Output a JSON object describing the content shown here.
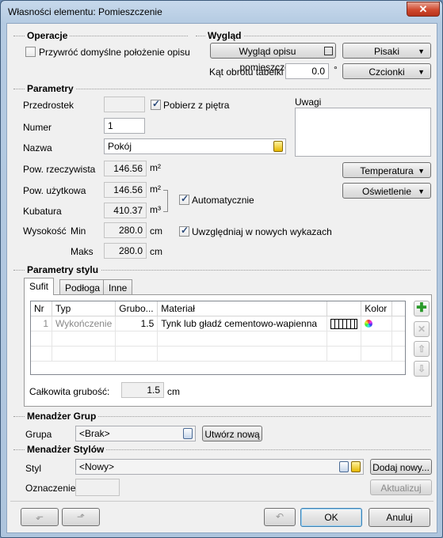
{
  "window": {
    "title": "Własności elementu: Pomieszczenie",
    "close": "✕"
  },
  "operacje": {
    "header": "Operacje",
    "restore_label": "Przywróć domyślne położenie opisu",
    "restore_checked": false
  },
  "wyglad": {
    "header": "Wygląd",
    "room_desc_button": "Wygląd opisu pomieszczeń",
    "pisaki_button": "Pisaki",
    "angle_label": "Kąt obrotu tabelki",
    "angle_value": "0.0",
    "angle_unit": "°",
    "czcionki_button": "Czcionki"
  },
  "parametry": {
    "header": "Parametry",
    "prefix_label": "Przedrostek",
    "prefix_value": "",
    "take_from_floor_label": "Pobierz z piętra",
    "take_from_floor_checked": true,
    "number_label": "Numer",
    "number_value": "1",
    "name_label": "Nazwa",
    "name_value": "Pokój",
    "notes_label": "Uwagi",
    "notes_value": "",
    "real_area_label": "Pow. rzeczywista",
    "real_area_value": "146.56",
    "real_area_unit": "m²",
    "usable_area_label": "Pow. użytkowa",
    "usable_area_value": "146.56",
    "usable_area_unit": "m²",
    "volume_label": "Kubatura",
    "volume_value": "410.37",
    "volume_unit": "m³",
    "auto_label": "Automatycznie",
    "auto_checked": true,
    "height_label": "Wysokość",
    "min_label": "Min",
    "min_value": "280.0",
    "min_unit": "cm",
    "max_label": "Maks",
    "max_value": "280.0",
    "max_unit": "cm",
    "include_label": "Uwzględniaj w nowych wykazach",
    "include_checked": true,
    "temperature_button": "Temperatura",
    "lighting_button": "Oświetlenie"
  },
  "styl": {
    "header": "Parametry stylu",
    "tabs": [
      "Sufit",
      "Podłoga",
      "Inne"
    ],
    "active_tab": "Sufit",
    "columns": [
      "Nr",
      "Typ",
      "Grubo...",
      "Materiał",
      "",
      "Kolor"
    ],
    "rows": [
      {
        "nr": "1",
        "typ": "Wykończenie",
        "grubosc": "1.5",
        "material": "Tynk lub gładź cementowo-wapienna"
      }
    ],
    "total_label": "Całkowita grubość:",
    "total_value": "1.5",
    "total_unit": "cm"
  },
  "grupy": {
    "header": "Menadżer Grup",
    "group_label": "Grupa",
    "group_value": "<Brak>",
    "create_button": "Utwórz nową"
  },
  "style_mgr": {
    "header": "Menadżer Stylów",
    "style_label": "Styl",
    "style_value": "<Nowy>",
    "add_button": "Dodaj nowy...",
    "mark_label": "Oznaczenie",
    "mark_value": "",
    "update_button": "Aktualizuj"
  },
  "footer": {
    "ok_button": "OK",
    "cancel_button": "Anuluj"
  }
}
